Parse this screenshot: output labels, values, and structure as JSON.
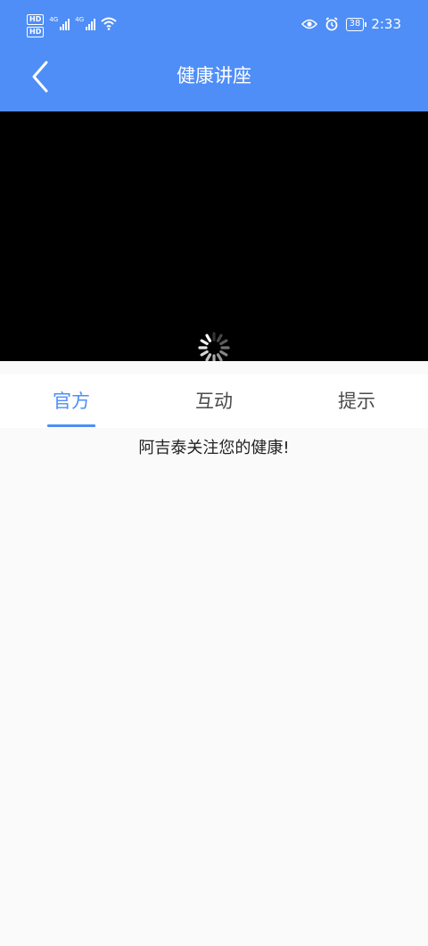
{
  "status_bar": {
    "network_left": "HD",
    "network_left_2": "HD",
    "signal_1": "4G",
    "signal_2": "4G",
    "battery": "38",
    "time": "2:33"
  },
  "header": {
    "title": "健康讲座",
    "back_icon": "chevron-left-icon"
  },
  "video": {
    "state": "loading",
    "spinner_icon": "loading-spinner-icon"
  },
  "tabs": [
    {
      "label": "官方",
      "active": true
    },
    {
      "label": "互动",
      "active": false
    },
    {
      "label": "提示",
      "active": false
    }
  ],
  "content": {
    "message": "阿吉泰关注您的健康!"
  },
  "colors": {
    "accent": "#4f8ef7",
    "video_bg": "#000000",
    "page_bg": "#fafafa"
  }
}
